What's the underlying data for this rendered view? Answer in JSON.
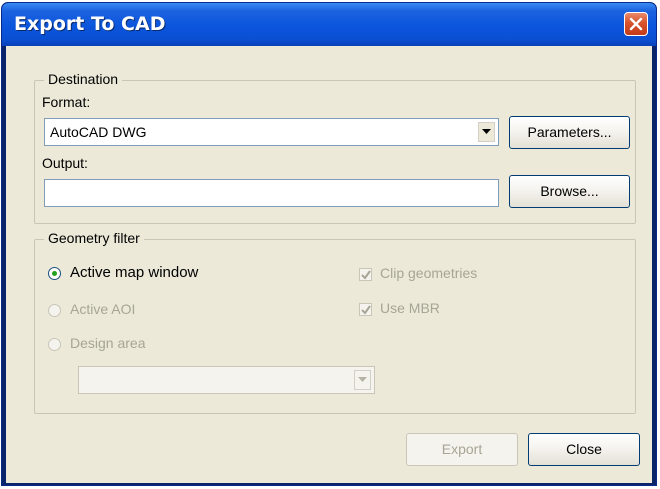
{
  "window": {
    "title": "Export To CAD",
    "close_icon": "close-x-icon"
  },
  "destination": {
    "group_label": "Destination",
    "format_label": "Format:",
    "format_value": "AutoCAD DWG",
    "parameters_button": "Parameters...",
    "output_label": "Output:",
    "output_value": "",
    "browse_button": "Browse..."
  },
  "geometry_filter": {
    "group_label": "Geometry filter",
    "options": [
      {
        "label": "Active map window",
        "selected": true,
        "enabled": true
      },
      {
        "label": "Active AOI",
        "selected": false,
        "enabled": false
      },
      {
        "label": "Design area",
        "selected": false,
        "enabled": false
      }
    ],
    "clip_geometries": {
      "label": "Clip geometries",
      "checked": true,
      "enabled": false
    },
    "use_mbr": {
      "label": "Use MBR",
      "checked": true,
      "enabled": false
    },
    "design_area_value": ""
  },
  "footer": {
    "export_button": "Export",
    "close_button": "Close"
  },
  "colors": {
    "title_bar": "#0a55dc",
    "dialog_bg": "#ece9d8",
    "selected_radio": "#21a121",
    "disabled_text": "#a7a595"
  }
}
